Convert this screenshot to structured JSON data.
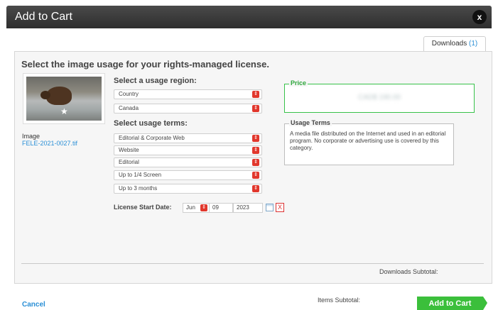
{
  "dialog": {
    "title": "Add to Cart",
    "close_label": "x"
  },
  "tabs": [
    {
      "label": "Downloads",
      "count": "(1)"
    }
  ],
  "heading": "Select the image usage for your rights-managed license.",
  "image": {
    "label": "Image",
    "filename": "FELE-2021-0027.tif"
  },
  "region": {
    "label": "Select a usage region:",
    "selects": [
      "Country",
      "Canada"
    ]
  },
  "terms": {
    "label": "Select usage terms:",
    "selects": [
      "Editorial & Corporate Web",
      "Website",
      "Editorial",
      "Up to 1/4 Screen",
      "Up to 3 months"
    ]
  },
  "license_date": {
    "label": "License Start Date:",
    "month": "Jun",
    "day": "09",
    "year": "2023",
    "clear_label": "X"
  },
  "price": {
    "legend": "Price",
    "value": "CAD$ 190.00"
  },
  "usage_terms": {
    "legend": "Usage Terms",
    "text": "A media file distributed on the Internet and used in an editorial program. No corporate or advertising use is covered by this category."
  },
  "footer": {
    "downloads_subtotal": "Downloads Subtotal:",
    "items_subtotal": "Items Subtotal:",
    "cancel": "Cancel",
    "add_to_cart": "Add to Cart"
  },
  "colors": {
    "accent": "#2a8fd6",
    "button": "#3bbf3b",
    "price_border": "#37c24a",
    "select_arrow": "#e1372c"
  }
}
